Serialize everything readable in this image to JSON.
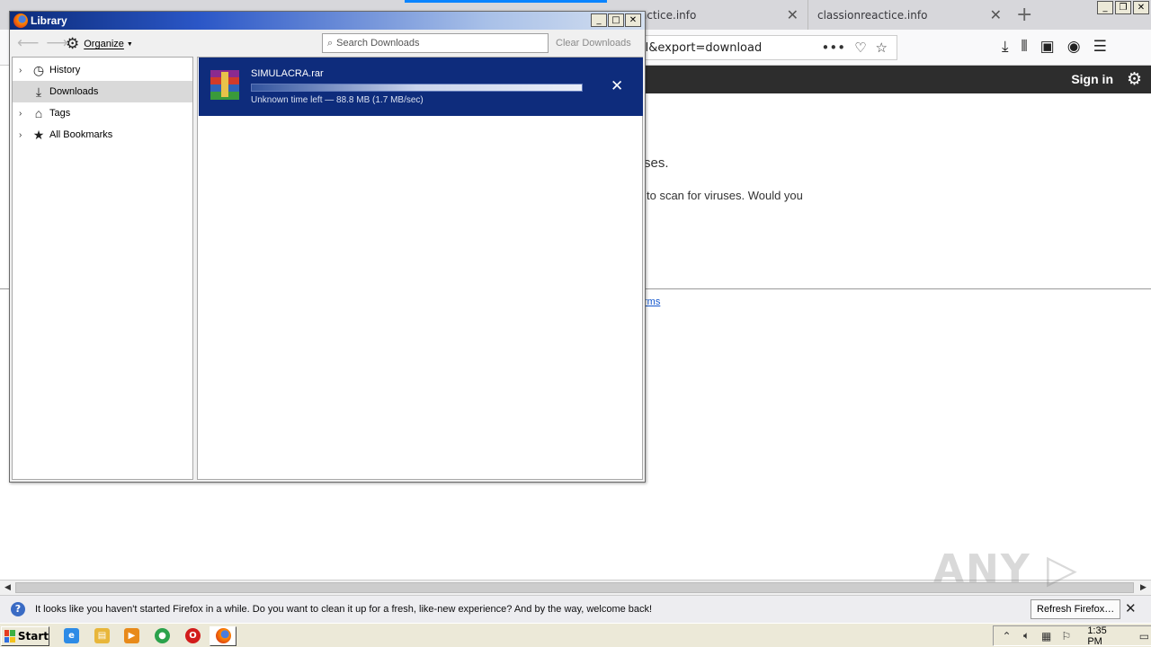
{
  "browser": {
    "tabs": [
      {
        "title": "reactice.info",
        "close": "✕"
      },
      {
        "title": "classionreactice.info",
        "close": "✕"
      }
    ],
    "new_tab_symbol": "+",
    "url_fragment": "ll&export=download",
    "url_icons": [
      "more-icon",
      "pocket-icon",
      "bookmark-star-icon"
    ],
    "toolbar_icons": [
      "download-icon",
      "library-icon",
      "sidebar-icon",
      "account-icon",
      "menu-icon"
    ],
    "window_buttons": [
      "_",
      "❐",
      "✕"
    ]
  },
  "page": {
    "sign_in": "Sign in",
    "text1": "ses.",
    "text2": "to scan for viruses. Would you",
    "terms_link": "rms",
    "watermark": "ANY ▷ RUN"
  },
  "library": {
    "title": "Library",
    "organize_label": "Organize",
    "search_placeholder": "Search Downloads",
    "clear_downloads": "Clear Downloads",
    "window_buttons": [
      "_",
      "□",
      "✕"
    ],
    "sidebar": [
      {
        "label": "History",
        "icon": "clock-icon",
        "expandable": true,
        "selected": false
      },
      {
        "label": "Downloads",
        "icon": "download-icon",
        "expandable": false,
        "selected": true
      },
      {
        "label": "Tags",
        "icon": "tag-icon",
        "expandable": true,
        "selected": false
      },
      {
        "label": "All Bookmarks",
        "icon": "star-icon",
        "expandable": true,
        "selected": false
      }
    ],
    "download": {
      "filename": "SIMULACRA.rar",
      "status": "Unknown time left — 88.8 MB (1.7 MB/sec)",
      "progress_fraction": 1.0,
      "cancel_symbol": "✕"
    }
  },
  "notification": {
    "message": "It looks like you haven't started Firefox in a while. Do you want to clean it up for a fresh, like-new experience? And by the way, welcome back!",
    "button": "Refresh Firefox…",
    "close": "✕"
  },
  "taskbar": {
    "start_label": "Start",
    "clock": "1:35 PM",
    "pinned": [
      "ie-icon",
      "explorer-icon",
      "media-player-icon",
      "chrome-icon",
      "opera-icon",
      "firefox-icon"
    ]
  },
  "colors": {
    "download_item_bg": "#0e2c7c",
    "title_gradient_start": "#0b2b7a",
    "drive_bar": "#2d2d2d"
  }
}
